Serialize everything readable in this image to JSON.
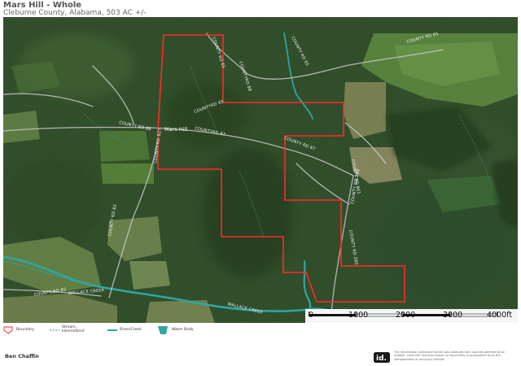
{
  "header": {
    "title": "Mars Hill - Whole",
    "subtitle": "Cleburne County, Alabama, 503 AC +/-"
  },
  "map": {
    "property_label": "Mars Hill",
    "road_labels": {
      "county_rd_65_north": "COUNTY RD 65",
      "county_rd_65_northeast": "COUNTY RD 65",
      "county_rd_65_east": "COUNTY RD 65",
      "countyrd_65_center": "COUNTYRD 65",
      "countyrd_87_center": "COUNTYRD 87",
      "countyrd_88_north": "COUNTYRD 88",
      "county_rd_88_west": "COUNTY RD 88",
      "county_rd_87_east": "COUNTY RD 87",
      "county_rd_861": "COUNTY RD 861",
      "county_rd_286": "COUNTY RD 286",
      "county_rd_280": "COUNTY RD 280",
      "county_rd_85_south": "COUNTY RD 85",
      "county_rd_82": "COUNTY RD 82",
      "county_rd_827": "COUNTY RD 827",
      "wallace_creek_1": "WALLACE CREEK",
      "wallace_creek_2": "WALLACE CREEK"
    },
    "scale_bar": {
      "labels": [
        "0",
        "1000",
        "2000",
        "3000",
        "4000ft"
      ]
    },
    "colors": {
      "boundary": "#ff2a2a",
      "water": "#2fa7a3",
      "road": "#c9c9c9"
    }
  },
  "legend": {
    "items": [
      {
        "label": "Boundary",
        "icon": "boundary-icon"
      },
      {
        "label": "Stream,\nIntermittent",
        "icon": "stream-intermittent-icon"
      },
      {
        "label": "River/Creek",
        "icon": "river-creek-icon"
      },
      {
        "label": "Water Body",
        "icon": "water-body-icon"
      }
    ]
  },
  "footer": {
    "author": "Ben Chaffin",
    "logo_text": "id.",
    "disclaimer": "The information contained herein was obtained from sources deemed to be reliable. Land id® Services makes no warranties or guarantees as to the completeness or accuracy thereof."
  }
}
